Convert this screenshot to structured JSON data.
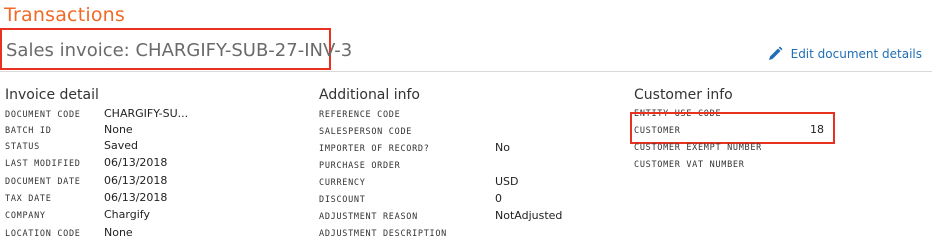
{
  "header": {
    "title": "Transactions",
    "subtitle": "Sales invoice: CHARGIFY-SUB-27-INV-3",
    "edit_label": "Edit document details"
  },
  "invoice_detail": {
    "title": "Invoice detail",
    "rows": [
      {
        "label": "DOCUMENT CODE",
        "value": "CHARGIFY-SU..."
      },
      {
        "label": "BATCH ID",
        "value": "None"
      },
      {
        "label": "STATUS",
        "value": "Saved"
      },
      {
        "label": "LAST MODIFIED",
        "value": "06/13/2018"
      },
      {
        "label": "DOCUMENT DATE",
        "value": "06/13/2018"
      },
      {
        "label": "TAX DATE",
        "value": "06/13/2018"
      },
      {
        "label": "COMPANY",
        "value": "Chargify"
      },
      {
        "label": "LOCATION CODE",
        "value": "None"
      }
    ]
  },
  "additional_info": {
    "title": "Additional info",
    "rows": [
      {
        "label": "REFERENCE CODE",
        "value": ""
      },
      {
        "label": "SALESPERSON CODE",
        "value": ""
      },
      {
        "label": "IMPORTER OF RECORD?",
        "value": "No"
      },
      {
        "label": "PURCHASE ORDER",
        "value": ""
      },
      {
        "label": "CURRENCY",
        "value": "USD"
      },
      {
        "label": "DISCOUNT",
        "value": "0"
      },
      {
        "label": "ADJUSTMENT REASON",
        "value": "NotAdjusted"
      },
      {
        "label": "ADJUSTMENT DESCRIPTION",
        "value": ""
      }
    ]
  },
  "customer_info": {
    "title": "Customer info",
    "rows": [
      {
        "label": "ENTITY USE CODE",
        "value": ""
      },
      {
        "label": "CUSTOMER",
        "value": "18"
      },
      {
        "label": "CUSTOMER EXEMPT NUMBER",
        "value": ""
      },
      {
        "label": "CUSTOMER VAT NUMBER",
        "value": ""
      }
    ]
  },
  "colors": {
    "accent": "#f06a25",
    "highlight_box": "#e8321f",
    "link": "#1f6eb6"
  },
  "icons": {
    "edit": "pencil-icon"
  }
}
